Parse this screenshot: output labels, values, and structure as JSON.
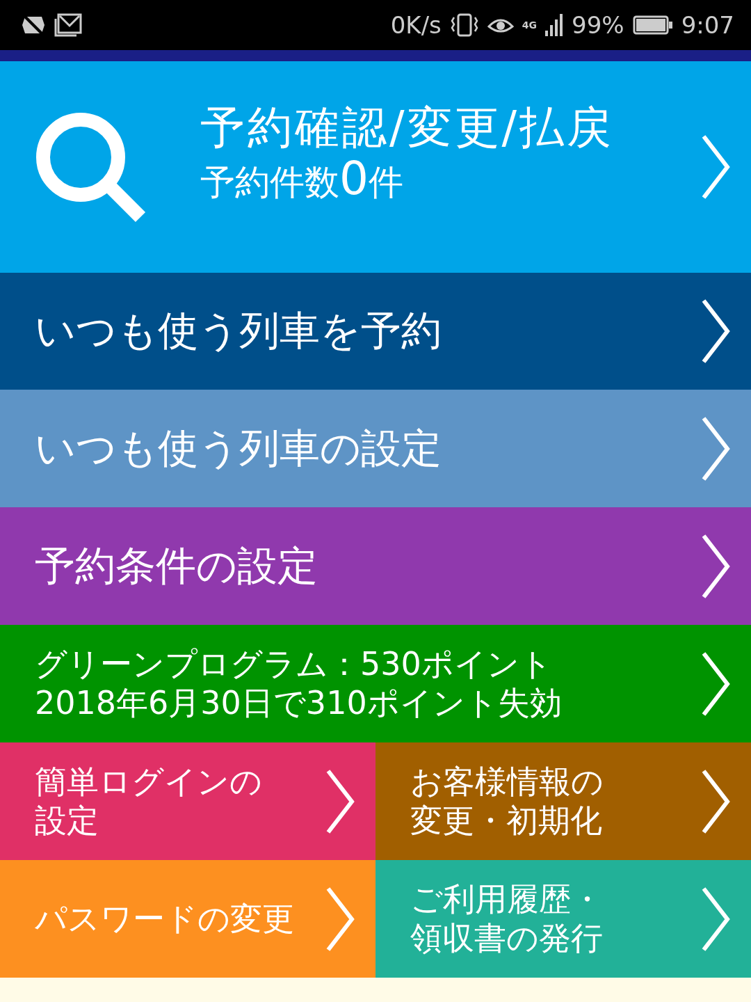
{
  "status_bar": {
    "speed": "0K/s",
    "network": "4G",
    "battery": "99%",
    "time": "9:07"
  },
  "hero": {
    "title": "予約確認/変更/払戻",
    "count_prefix": "予約件数",
    "count": "0",
    "count_suffix": "件",
    "color": "#00a5e8"
  },
  "menu": [
    {
      "lines": [
        "いつも使う列車を予約"
      ],
      "color": "#004f8a",
      "kind": "large"
    },
    {
      "lines": [
        "いつも使う列車の設定"
      ],
      "color": "#5e94c6",
      "kind": "large"
    },
    {
      "lines": [
        "予約条件の設定"
      ],
      "color": "#9039ad",
      "kind": "large"
    },
    {
      "lines": [
        "グリーンプログラム：530ポイント",
        "2018年6月30日で310ポイント失効"
      ],
      "color": "#009300",
      "kind": "medium"
    }
  ],
  "tiles": [
    {
      "lines": [
        "簡単ログインの",
        "設定"
      ],
      "color": "#e03066"
    },
    {
      "lines": [
        "お客様情報の",
        "変更・初期化"
      ],
      "color": "#a15f00"
    },
    {
      "lines": [
        "パスワードの変更"
      ],
      "color": "#fd9020"
    },
    {
      "lines": [
        "ご利用履歴・",
        "領収書の発行"
      ],
      "color": "#22b198"
    }
  ]
}
